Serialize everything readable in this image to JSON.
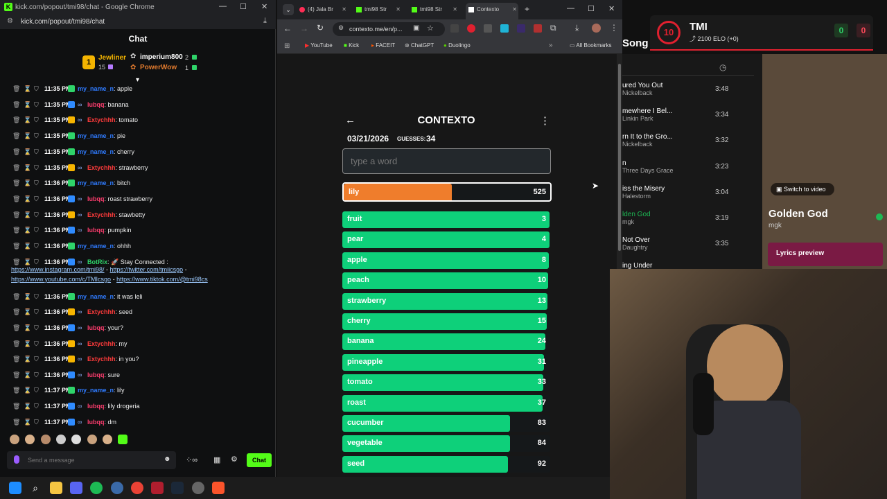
{
  "chat_window": {
    "title": "kick.com/popout/tmi98/chat - Google Chrome",
    "url": "kick.com/popout/tmi98/chat",
    "header": "Chat",
    "leaderboard": {
      "first_rank": "1",
      "first_name": "Jewliner",
      "first_count": "15",
      "second_name": "imperium800",
      "second_count": "2",
      "third_name": "PowerWow",
      "third_count": "1"
    },
    "messages": [
      {
        "time": "11:35 PM",
        "user": "my_name_n",
        "text": ": apple",
        "color": "#2f7bff",
        "badge": "#2fd46a"
      },
      {
        "time": "11:35 PM",
        "user": "lubqq",
        "text": ": banana",
        "color": "#ff3d6e",
        "badge": "#2f8bff"
      },
      {
        "time": "11:35 PM",
        "user": "Extychhh",
        "text": ": tomato",
        "color": "#ff3b3b",
        "badge": "#f7b500"
      },
      {
        "time": "11:35 PM",
        "user": "my_name_n",
        "text": ": pie",
        "color": "#2f7bff",
        "badge": "#2fd46a"
      },
      {
        "time": "11:35 PM",
        "user": "my_name_n",
        "text": ": cherry",
        "color": "#2f7bff",
        "badge": "#2fd46a"
      },
      {
        "time": "11:35 PM",
        "user": "Extychhh",
        "text": ": strawberry",
        "color": "#ff3b3b",
        "badge": "#f7b500"
      },
      {
        "time": "11:36 PM",
        "user": "my_name_n",
        "text": ": bitch",
        "color": "#2f7bff",
        "badge": "#2fd46a"
      },
      {
        "time": "11:36 PM",
        "user": "lubqq",
        "text": ": roast strawberry",
        "color": "#ff3d6e",
        "badge": "#2f8bff"
      },
      {
        "time": "11:36 PM",
        "user": "Extychhh",
        "text": ": stawbetty",
        "color": "#ff3b3b",
        "badge": "#f7b500"
      },
      {
        "time": "11:36 PM",
        "user": "lubqq",
        "text": ": pumpkin",
        "color": "#ff3d6e",
        "badge": "#2f8bff"
      },
      {
        "time": "11:36 PM",
        "user": "my_name_n",
        "text": ": ohhh",
        "color": "#2f7bff",
        "badge": "#2fd46a"
      }
    ],
    "bot_message": {
      "time": "11:36 PM",
      "user": "BotRix",
      "text": ": 🚀 Stay Connected :",
      "link1": "https://www.instagram.com/tmi98/",
      "sep1": " - ",
      "link2": "https://twitter.com/tmiicsgo",
      "sep2": " -",
      "link3": "https://www.youtube.com/c/TMIcsgo",
      "sep3": " - ",
      "link4": "https://www.tiktok.com/@tmi98cs"
    },
    "messages2": [
      {
        "time": "11:36 PM",
        "user": "my_name_n",
        "text": ": it was leli",
        "color": "#2f7bff",
        "badge": "#2fd46a"
      },
      {
        "time": "11:36 PM",
        "user": "Extychhh",
        "text": ": seed",
        "color": "#ff3b3b",
        "badge": "#f7b500"
      },
      {
        "time": "11:36 PM",
        "user": "lubqq",
        "text": ": your?",
        "color": "#ff3d6e",
        "badge": "#2f8bff"
      },
      {
        "time": "11:36 PM",
        "user": "Extychhh",
        "text": ": my",
        "color": "#ff3b3b",
        "badge": "#f7b500"
      },
      {
        "time": "11:36 PM",
        "user": "Extychhh",
        "text": ": in you?",
        "color": "#ff3b3b",
        "badge": "#f7b500"
      },
      {
        "time": "11:36 PM",
        "user": "lubqq",
        "text": ": sure",
        "color": "#ff3d6e",
        "badge": "#2f8bff"
      },
      {
        "time": "11:37 PM",
        "user": "my_name_n",
        "text": ": lily",
        "color": "#2f7bff",
        "badge": "#2fd46a"
      },
      {
        "time": "11:37 PM",
        "user": "lubqq",
        "text": ": lily drogeria",
        "color": "#ff3d6e",
        "badge": "#2f8bff"
      },
      {
        "time": "11:37 PM",
        "user": "lubqq",
        "text": ": dm",
        "color": "#ff3d6e",
        "badge": "#2f8bff"
      }
    ],
    "composer_placeholder": "Send a message",
    "chat_button": "Chat"
  },
  "browser": {
    "tabs": [
      "(4) Jala Br",
      "tmi98 Str",
      "tmi98 Str",
      "Contexto"
    ],
    "url": "contexto.me/en/p...",
    "bookmarks": [
      "YouTube",
      "Kick",
      "FACEIT",
      "ChatGPT",
      "Duolingo"
    ],
    "all_bookmarks": "All Bookmarks"
  },
  "contexto": {
    "title": "CONTEXTO",
    "date": "03/21/2026",
    "guesses_label": "GUESSES:",
    "guesses": "34",
    "input_placeholder": "type a word",
    "last_guess": {
      "word": "lily",
      "rank": "525",
      "fill_fraction": 0.52
    },
    "guesses_list": [
      {
        "word": "fruit",
        "rank": "3",
        "fill_fraction": 0.998
      },
      {
        "word": "pear",
        "rank": "4",
        "fill_fraction": 0.997
      },
      {
        "word": "apple",
        "rank": "8",
        "fill_fraction": 0.993
      },
      {
        "word": "peach",
        "rank": "10",
        "fill_fraction": 0.99
      },
      {
        "word": "strawberry",
        "rank": "13",
        "fill_fraction": 0.986
      },
      {
        "word": "cherry",
        "rank": "15",
        "fill_fraction": 0.984
      },
      {
        "word": "banana",
        "rank": "24",
        "fill_fraction": 0.977
      },
      {
        "word": "pineapple",
        "rank": "31",
        "fill_fraction": 0.97
      },
      {
        "word": "tomato",
        "rank": "33",
        "fill_fraction": 0.968
      },
      {
        "word": "roast",
        "rank": "37",
        "fill_fraction": 0.964
      },
      {
        "word": "cucumber",
        "rank": "83",
        "fill_fraction": 0.908
      },
      {
        "word": "vegetable",
        "rank": "84",
        "fill_fraction": 0.907
      },
      {
        "word": "seed",
        "rank": "92",
        "fill_fraction": 0.898
      }
    ]
  },
  "faceit": {
    "level": "10",
    "name": "TMI",
    "elo": "2100 ELO (+0)",
    "score_left": "0",
    "score_right": "0"
  },
  "spotify": {
    "header_partial": "Song",
    "songs": [
      {
        "title": "ured You Out",
        "artist": "Nickelback",
        "duration": "3:48"
      },
      {
        "title": "mewhere I Bel...",
        "artist": "Linkin Park",
        "duration": "3:34"
      },
      {
        "title": "rn It to the Gro...",
        "artist": "Nickelback",
        "duration": "3:32"
      },
      {
        "title": "n",
        "artist": "Three Days Grace",
        "duration": "3:23"
      },
      {
        "title": "iss the Misery",
        "artist": "Halestorm",
        "duration": "3:04"
      },
      {
        "title": "lden God",
        "artist": "mgk",
        "duration": "3:19"
      },
      {
        "title": "Not Over",
        "artist": "Daughtry",
        "duration": "3:35"
      },
      {
        "title": "ing Under",
        "artist": "",
        "duration": ""
      }
    ],
    "switch_video": "Switch to video",
    "now_playing": "Golden God",
    "now_artist": "mgk",
    "lyrics": "Lyrics preview"
  }
}
